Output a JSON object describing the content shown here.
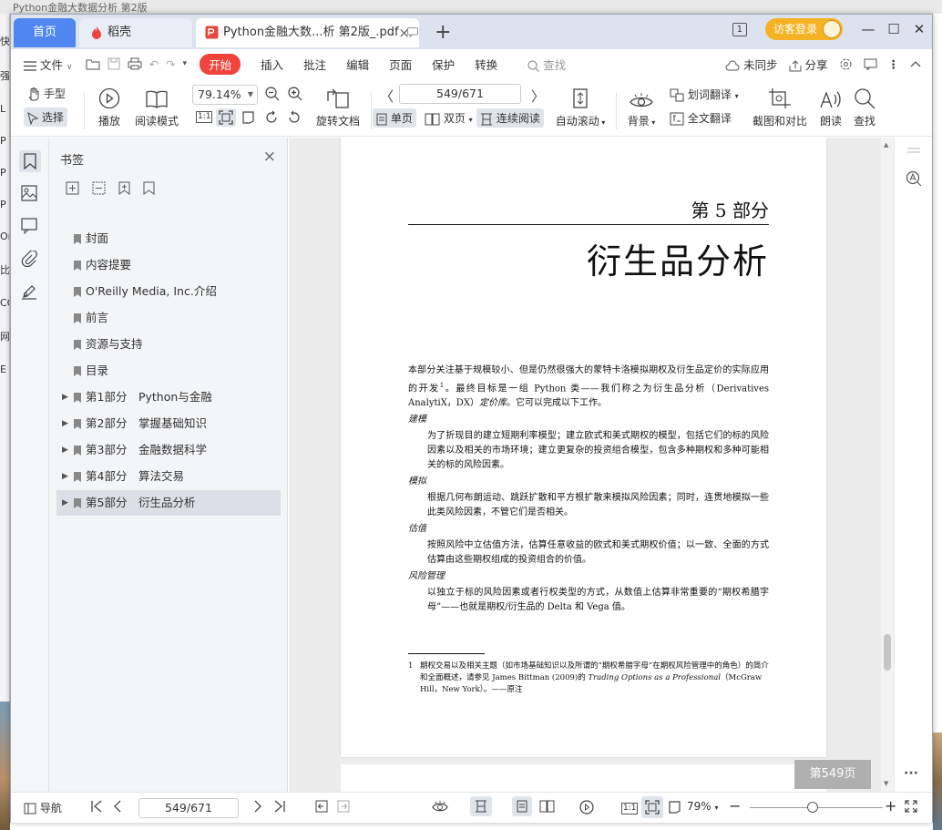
{
  "desktop": {
    "behind_title": "Python金融大数据分析 第2版",
    "left_strip_chars": [
      "快",
      "强",
      "L",
      "P",
      "P",
      "P",
      "On",
      "比",
      "CO",
      "网",
      "E"
    ]
  },
  "tabs": {
    "home": "首页",
    "docer": "稻壳",
    "doc": "Python金融大数...析 第2版_.pdf",
    "close": "×",
    "new": "+"
  },
  "window": {
    "badge": "1",
    "login": "访客登录",
    "min": "—",
    "max": "☐",
    "close": "✕"
  },
  "menu": {
    "file": "文件",
    "items": [
      "开始",
      "插入",
      "批注",
      "编辑",
      "页面",
      "保护",
      "转换"
    ],
    "search": "查找",
    "sync": "未同步",
    "share": "分享"
  },
  "toolbar": {
    "hand": "手型",
    "select": "选择",
    "play": "播放",
    "read_mode": "阅读模式",
    "zoom": "79.14%",
    "rotate_doc": "旋转文档",
    "page_field": "549/671",
    "single": "单页",
    "double": "双页",
    "continuous": "连续阅读",
    "auto_scroll": "自动滚动",
    "background": "背景",
    "word_translate": "划词翻译",
    "full_translate": "全文翻译",
    "screenshot_compare": "截图和对比",
    "read_aloud": "朗读",
    "find": "查找",
    "actual_size": "1:1"
  },
  "bookmarks": {
    "title": "书签",
    "close": "×",
    "items": [
      {
        "label": "封面",
        "expandable": false,
        "active": false
      },
      {
        "label": "内容提要",
        "expandable": false,
        "active": false
      },
      {
        "label": "O'Reilly Media, Inc.介绍",
        "expandable": false,
        "active": false
      },
      {
        "label": "前言",
        "expandable": false,
        "active": false
      },
      {
        "label": "资源与支持",
        "expandable": false,
        "active": false
      },
      {
        "label": "目录",
        "expandable": false,
        "active": false
      },
      {
        "label": "第1部分　Python与金融",
        "expandable": true,
        "active": false
      },
      {
        "label": "第2部分　掌握基础知识",
        "expandable": true,
        "active": false
      },
      {
        "label": "第3部分　金融数据科学",
        "expandable": true,
        "active": false
      },
      {
        "label": "第4部分　算法交易",
        "expandable": true,
        "active": false
      },
      {
        "label": "第5部分　衍生品分析",
        "expandable": true,
        "active": true
      }
    ]
  },
  "page": {
    "part": "第 5 部分",
    "title": "衍生品分析",
    "intro_1": "本部分关注基于规模较小、但是仍然很强大的蒙特卡洛模拟期权及衍生品定价的实际应用的开发",
    "intro_sup": "1",
    "intro_2": "。最终目标是一组 Python 类——我们称之为衍生品分析（Derivatives AnalytiX，DX）",
    "intro_em": "定价库",
    "intro_3": "。它可以完成以下工作。",
    "sections": [
      {
        "heading": "建模",
        "text": "为了折现目的建立短期利率模型；建立欧式和美式期权的模型，包括它们的标的风险因素以及相关的市场环境；建立更复杂的投资组合模型，包含多种期权和多种可能相关的标的风险因素。"
      },
      {
        "heading": "模拟",
        "text": "根据几何布朗运动、跳跃扩散和平方根扩散来模拟风险因素；同时，连贯地模拟一些此类风险因素，不管它们是否相关。"
      },
      {
        "heading": "估值",
        "text": "按照风险中立估值方法，估算任意收益的欧式和美式期权价值；以一致、全面的方式估算由这些期权组成的投资组合的价值。"
      },
      {
        "heading": "风险管理",
        "text": "以独立于标的风险因素或者行权类型的方式，从数值上估算非常重要的“期权希腊字母”——也就是期权/衍生品的 Delta 和 Vega 值。"
      }
    ],
    "footnote_num": "1",
    "footnote_1": "期权交易以及相关主题（如市场基础知识以及所谓的“期权希腊字母”在期权风险管理中的角色）的简介和全面概述，请参见 James Bittman (2009)的 ",
    "footnote_em": "Trading Options as a Professional",
    "footnote_2": "（McGraw Hill，New York）。——原注",
    "badge": "第549页"
  },
  "status": {
    "nav": "导航",
    "page_field": "549/671",
    "zoom": "79%",
    "actual_size": "1:1",
    "zoom_level": 0.45
  }
}
